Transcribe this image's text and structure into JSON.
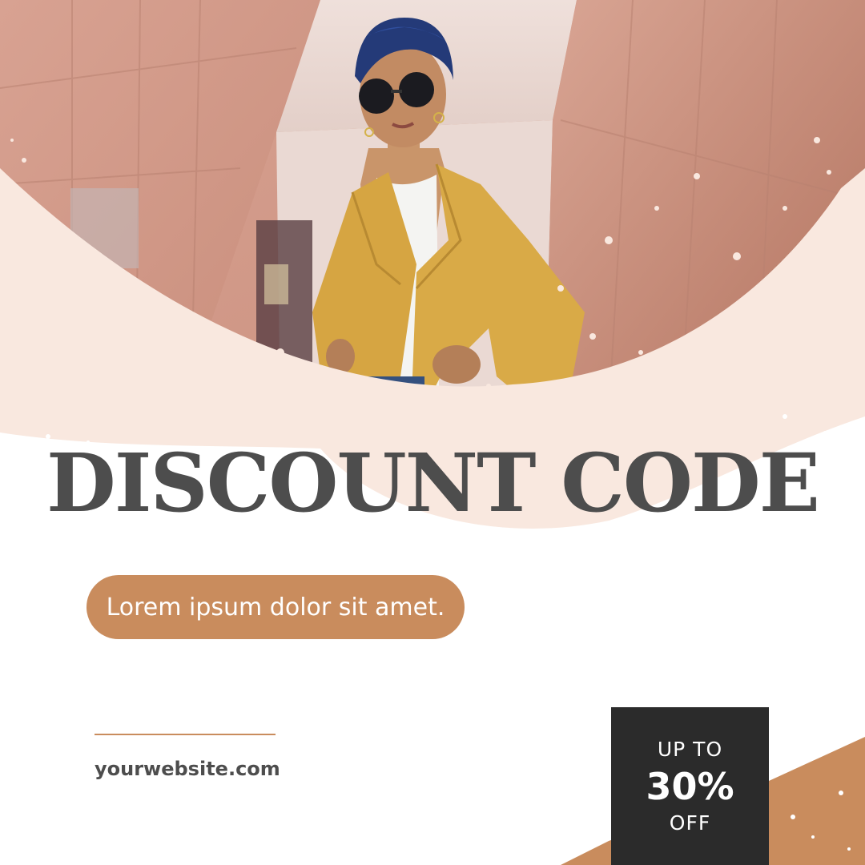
{
  "colors": {
    "accent": "#c98c5d",
    "text_dark": "#4d4d4d",
    "badge_bg": "#2b2b2b",
    "blush": "#f9e8df"
  },
  "hero": {
    "photo_subject": "woman in navy turban, sunglasses, mustard jacket and white top"
  },
  "headline": "DISCOUNT CODE",
  "tagline": "Lorem ipsum dolor sit amet.",
  "footer": {
    "website": "yourwebsite.com"
  },
  "badge": {
    "line1": "UP TO",
    "value": "30%",
    "line2": "OFF"
  }
}
